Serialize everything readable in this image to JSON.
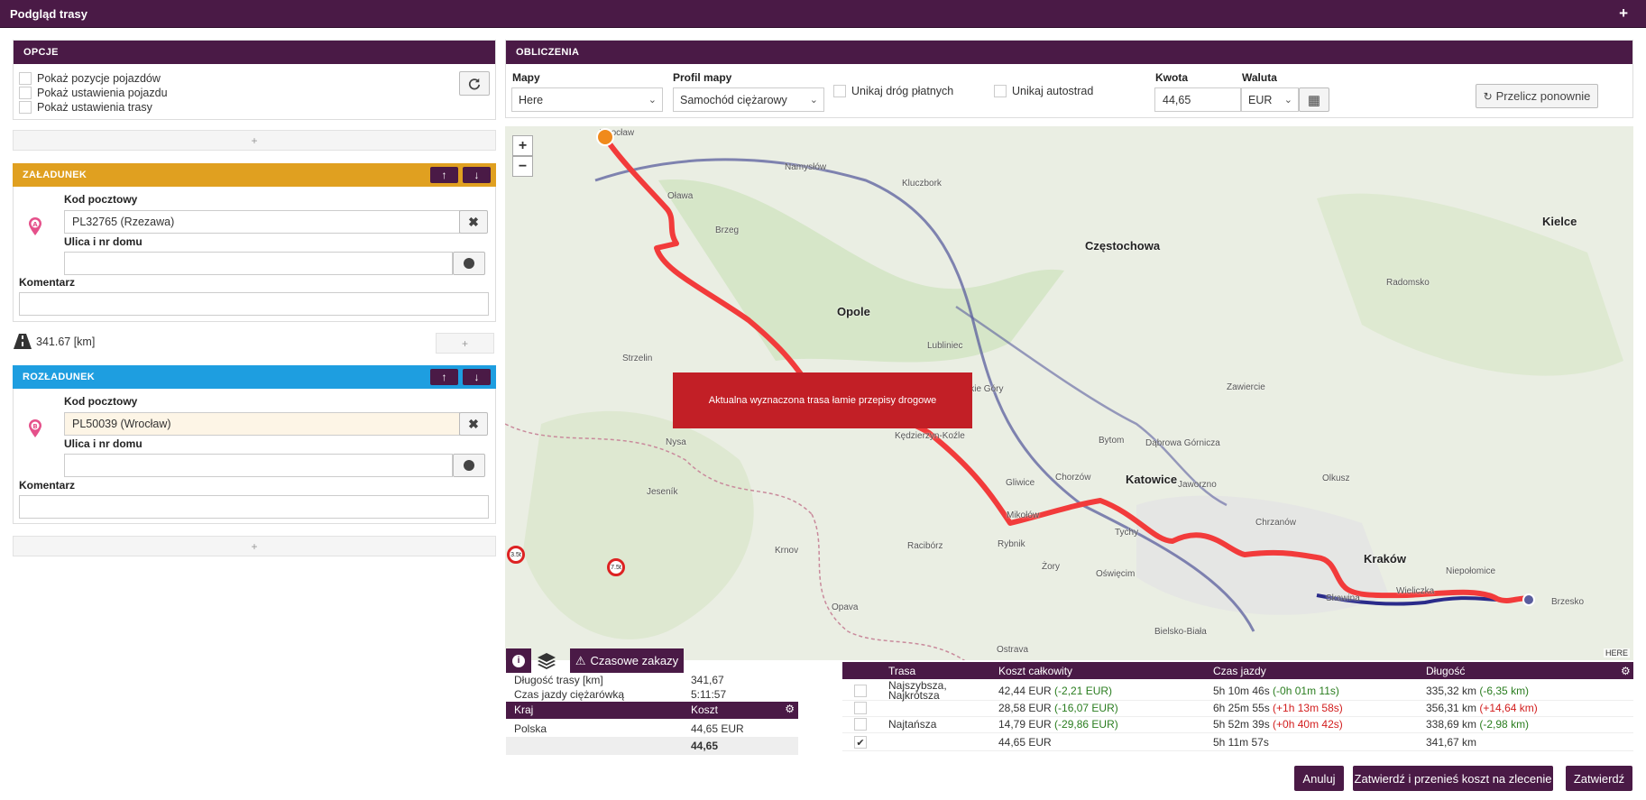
{
  "window": {
    "title": "Podgląd trasy",
    "add_label": "+"
  },
  "options": {
    "header": "OPCJE",
    "items": [
      "Pokaż pozycje pojazdów",
      "Pokaż ustawienia pojazdu",
      "Pokaż ustawienia trasy"
    ],
    "add_label": "+"
  },
  "loading": {
    "header": "ZAŁADUNEK",
    "color": "#e0a020",
    "marker": "A",
    "postal_label": "Kod pocztowy",
    "postal_value": "PL32765 (Rzezawa)",
    "street_label": "Ulica i nr domu",
    "street_value": "",
    "comment_label": "Komentarz",
    "comment_value": ""
  },
  "distance": {
    "value": "341.67 [km]",
    "add_label": "+"
  },
  "unloading": {
    "header": "ROZŁADUNEK",
    "color": "#1e9ee0",
    "marker": "B",
    "postal_label": "Kod pocztowy",
    "postal_value": "PL50039 (Wrocław)",
    "street_label": "Ulica i nr domu",
    "street_value": "",
    "comment_label": "Komentarz",
    "comment_value": ""
  },
  "bottom_add_label": "+",
  "calc": {
    "header": "OBLICZENIA",
    "maps_label": "Mapy",
    "maps_value": "Here",
    "profile_label": "Profil mapy",
    "profile_value": "Samochód ciężarowy",
    "avoid_toll": "Unikaj dróg płatnych",
    "avoid_highway": "Unikaj autostrad",
    "amount_label": "Kwota",
    "amount_value": "44,65",
    "currency_label": "Waluta",
    "currency_value": "EUR",
    "recalc_label": "Przelicz ponownie"
  },
  "map": {
    "zoom_in": "+",
    "zoom_out": "−",
    "alert": "Aktualna wyznaczona trasa łamie przepisy drogowe",
    "route_color": "#f23b3b",
    "alt_route_color": "#5a5d9e",
    "labels": [
      {
        "t": "Wrocław",
        "big": false
      },
      {
        "t": "Opole",
        "big": true
      },
      {
        "t": "Częstochowa",
        "big": true
      },
      {
        "t": "Katowice",
        "big": true
      },
      {
        "t": "Kraków",
        "big": true
      },
      {
        "t": "Kielce",
        "big": true
      },
      {
        "t": "Gliwice",
        "big": false
      },
      {
        "t": "Chorzów",
        "big": false
      },
      {
        "t": "Bytom",
        "big": false
      },
      {
        "t": "Tychy",
        "big": false
      },
      {
        "t": "Rybnik",
        "big": false
      },
      {
        "t": "Ostrava",
        "big": false
      },
      {
        "t": "Opava",
        "big": false
      },
      {
        "t": "Brzeg",
        "big": false
      },
      {
        "t": "Oława",
        "big": false
      },
      {
        "t": "Namysłów",
        "big": false
      },
      {
        "t": "Kluczbork",
        "big": false
      },
      {
        "t": "Dąbrowa Górnicza",
        "big": false
      },
      {
        "t": "Jaworzno",
        "big": false
      },
      {
        "t": "Wieliczka",
        "big": false
      },
      {
        "t": "Niepołomice",
        "big": false
      },
      {
        "t": "Brzesko",
        "big": false
      },
      {
        "t": "Tarnowskie Góry",
        "big": false
      },
      {
        "t": "Zawiercie",
        "big": false
      },
      {
        "t": "Lubliniec",
        "big": false
      },
      {
        "t": "Kędzierzyn-Koźle",
        "big": false
      },
      {
        "t": "Racibórz",
        "big": false
      },
      {
        "t": "Strzelin",
        "big": false
      },
      {
        "t": "Nysa",
        "big": false
      },
      {
        "t": "Jeseník",
        "big": false
      },
      {
        "t": "Krnov",
        "big": false
      },
      {
        "t": "Bielsko-Biała",
        "big": false
      },
      {
        "t": "Oświęcim",
        "big": false
      },
      {
        "t": "Chrzanów",
        "big": false
      },
      {
        "t": "Olkusz",
        "big": false
      },
      {
        "t": "Radomsko",
        "big": false
      },
      {
        "t": "Skawina",
        "big": false
      },
      {
        "t": "Żory",
        "big": false
      },
      {
        "t": "Mikołów",
        "big": false
      }
    ],
    "signs": [
      "3.5t",
      "7.5t"
    ],
    "brand": "HERE"
  },
  "tabs": {
    "info_icon": "info-icon",
    "layers_icon": "layers-icon",
    "time_ban": "Czasowe zakazy"
  },
  "summary": {
    "rows": [
      {
        "k": "Długość trasy [km]",
        "v": "341,67"
      },
      {
        "k": "Czas jazdy ciężarówką",
        "v": "5:11:57"
      }
    ],
    "country_header": "Kraj",
    "cost_header": "Koszt",
    "countries": [
      {
        "k": "Polska",
        "v": "44,65 EUR"
      }
    ],
    "total": "44,65"
  },
  "routes": {
    "headers": [
      "Trasa",
      "Koszt całkowity",
      "Czas jazdy",
      "Długość"
    ],
    "rows": [
      {
        "name": "Najszybsza, Najkrótsza",
        "checked": false,
        "cost": "42,44 EUR",
        "cost_d": "(-2,21 EUR)",
        "cost_c": "g",
        "time": "5h 10m 46s",
        "time_d": "(-0h 01m 11s)",
        "time_c": "g",
        "len": "335,32 km",
        "len_d": "(-6,35 km)",
        "len_c": "g"
      },
      {
        "name": "",
        "checked": false,
        "cost": "28,58 EUR",
        "cost_d": "(-16,07 EUR)",
        "cost_c": "g",
        "time": "6h 25m 55s",
        "time_d": "(+1h 13m 58s)",
        "time_c": "r",
        "len": "356,31 km",
        "len_d": "(+14,64 km)",
        "len_c": "r"
      },
      {
        "name": "Najtańsza",
        "checked": false,
        "cost": "14,79 EUR",
        "cost_d": "(-29,86 EUR)",
        "cost_c": "g",
        "time": "5h 52m 39s",
        "time_d": "(+0h 40m 42s)",
        "time_c": "r",
        "len": "338,69 km",
        "len_d": "(-2,98 km)",
        "len_c": "g"
      },
      {
        "name": "",
        "checked": true,
        "cost": "44,65 EUR",
        "cost_d": "",
        "cost_c": "g",
        "time": "5h 11m 57s",
        "time_d": "",
        "time_c": "g",
        "len": "341,67 km",
        "len_d": "",
        "len_c": "g"
      }
    ]
  },
  "buttons": {
    "cancel": "Anuluj",
    "confirm_transfer": "Zatwierdź i przenieś koszt na zlecenie",
    "confirm": "Zatwierdź"
  }
}
